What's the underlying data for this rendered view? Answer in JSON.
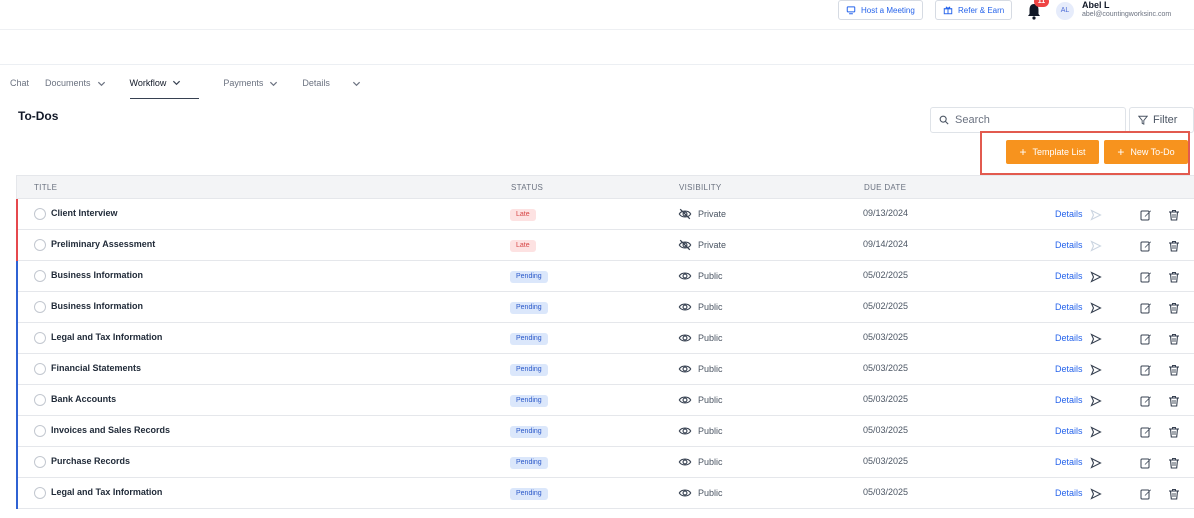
{
  "header": {
    "host_meeting": "Host a Meeting",
    "refer_earn": "Refer & Earn",
    "notif_count": "11",
    "avatar_initials": "AL",
    "user_name": "Abel L",
    "user_email": "abel@countingworksinc.com"
  },
  "tabs": [
    {
      "label": "Chat"
    },
    {
      "label": "Documents"
    },
    {
      "label": "Workflow"
    },
    {
      "label": "Payments"
    },
    {
      "label": "Details"
    }
  ],
  "page_title": "To-Dos",
  "search": {
    "placeholder": "Search"
  },
  "filter_label": "Filter",
  "actions": {
    "template_list": "Template List",
    "new_todo": "New To-Do"
  },
  "columns": {
    "title": "TITLE",
    "status": "STATUS",
    "visibility": "VISIBILITY",
    "due_date": "DUE DATE"
  },
  "details_label": "Details",
  "colors": {
    "late_bar": "#e5484d",
    "pending_bar": "#2f62d3",
    "accent": "#f7931e",
    "highlight": "#e25a4f"
  },
  "rows": [
    {
      "title": "Client Interview",
      "status": "Late",
      "visibility": "Private",
      "due": "09/13/2024"
    },
    {
      "title": "Preliminary Assessment",
      "status": "Late",
      "visibility": "Private",
      "due": "09/14/2024"
    },
    {
      "title": "Business Information",
      "status": "Pending",
      "visibility": "Public",
      "due": "05/02/2025"
    },
    {
      "title": "Business Information",
      "status": "Pending",
      "visibility": "Public",
      "due": "05/02/2025"
    },
    {
      "title": "Legal and Tax Information",
      "status": "Pending",
      "visibility": "Public",
      "due": "05/03/2025"
    },
    {
      "title": "Financial Statements",
      "status": "Pending",
      "visibility": "Public",
      "due": "05/03/2025"
    },
    {
      "title": "Bank Accounts",
      "status": "Pending",
      "visibility": "Public",
      "due": "05/03/2025"
    },
    {
      "title": "Invoices and Sales Records",
      "status": "Pending",
      "visibility": "Public",
      "due": "05/03/2025"
    },
    {
      "title": "Purchase Records",
      "status": "Pending",
      "visibility": "Public",
      "due": "05/03/2025"
    },
    {
      "title": "Legal and Tax Information",
      "status": "Pending",
      "visibility": "Public",
      "due": "05/03/2025"
    }
  ]
}
